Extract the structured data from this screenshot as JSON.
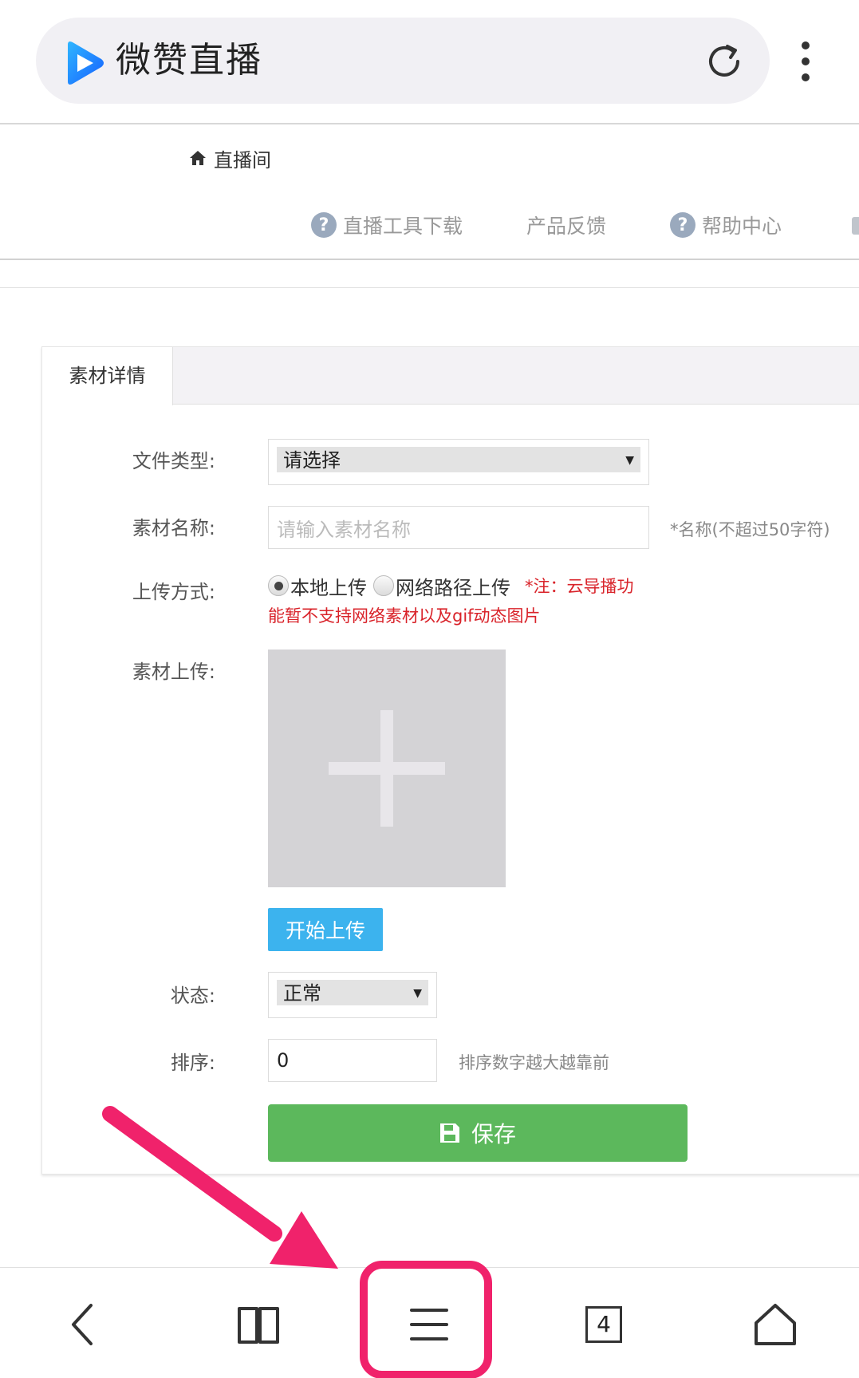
{
  "browser": {
    "site_title": "微赞直播",
    "tab_count": "4",
    "icons": {
      "logo": "play-logo-icon",
      "reload": "reload-icon",
      "menu": "kebab-menu-icon",
      "back": "back-arrow-icon",
      "bookmarks": "book-icon",
      "main_menu": "hamburger-menu-icon",
      "home": "home-icon"
    }
  },
  "header": {
    "home_link": "直播间",
    "nav_links": [
      {
        "label": "直播工具下载",
        "icon": "?"
      },
      {
        "label": "产品反馈"
      },
      {
        "label": "帮助中心",
        "icon": "?"
      }
    ]
  },
  "panel": {
    "tab_label": "素材详情",
    "fields": {
      "file_type": {
        "label": "文件类型:",
        "value": "请选择"
      },
      "name": {
        "label": "素材名称:",
        "placeholder": "请输入素材名称",
        "hint": "*名称(不超过50字符)"
      },
      "upload_method": {
        "label": "上传方式:",
        "options": [
          "本地上传",
          "网络路径上传"
        ],
        "selected": "本地上传",
        "note_line1": "*注：云导播功",
        "note_line2": "能暂不支持网络素材以及gif动态图片"
      },
      "upload": {
        "label": "素材上传:",
        "button": "开始上传"
      },
      "status": {
        "label": "状态:",
        "value": "正常"
      },
      "sort": {
        "label": "排序:",
        "value": "0",
        "hint": "排序数字越大越靠前"
      }
    },
    "save_button": "保存"
  },
  "colors": {
    "save_green": "#5cb85c",
    "upload_blue": "#3cb3ee",
    "note_red": "#d9232a",
    "annotation_pink": "#f0226b",
    "logo_blue": "#1a8cff"
  }
}
